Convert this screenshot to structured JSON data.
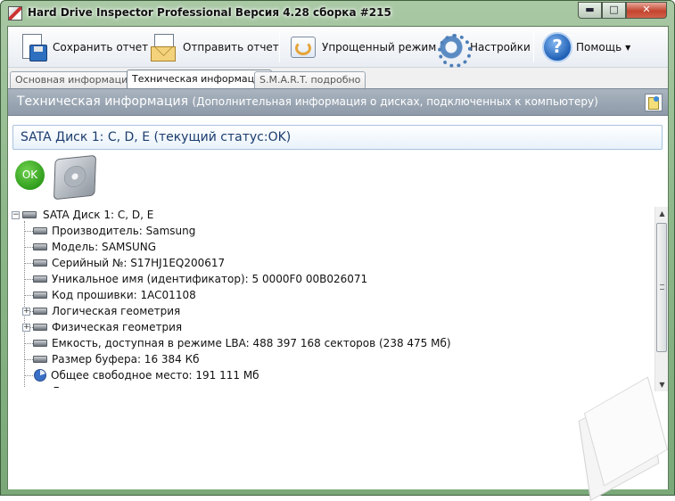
{
  "window": {
    "title": "Hard Drive Inspector Professional Версия 4.28 сборка #215"
  },
  "toolbar": {
    "save_label": "Сохранить отчет",
    "send_label": "Отправить отчет",
    "simple_label": "Упрощенный режим",
    "settings_label": "Настройки",
    "help_label": "Помощь"
  },
  "tabs": [
    {
      "label": "Основная информация",
      "active": false
    },
    {
      "label": "Техническая информация",
      "active": true
    },
    {
      "label": "S.M.A.R.T. подробно",
      "active": false
    }
  ],
  "panel": {
    "title": "Техническая информация",
    "subtitle": "(Дополнительная информация о дисках, подключенных к компьютеру)"
  },
  "disk": {
    "header": "SATA Диск 1: C, D, E (текущий статус:OK)",
    "status_badge": "OK"
  },
  "tree": {
    "root": "SATA Диск 1: C, D, E",
    "items": [
      {
        "text": "Производитель: Samsung",
        "icon": "hdd-icon",
        "expandable": false
      },
      {
        "text": "Модель: SAMSUNG",
        "icon": "hdd-icon",
        "expandable": false
      },
      {
        "text": "Серийный №: S17HJ1EQ200617",
        "icon": "hdd-icon",
        "expandable": false
      },
      {
        "text": "Уникальное имя (идентификатор): 5 0000F0 00B026071",
        "icon": "hdd-icon",
        "expandable": false
      },
      {
        "text": "Код прошивки: 1AC01108",
        "icon": "hdd-icon",
        "expandable": false
      },
      {
        "text": "Логическая геометрия",
        "icon": "hdd-icon",
        "expandable": true
      },
      {
        "text": "Физическая геометрия",
        "icon": "hdd-icon",
        "expandable": true
      },
      {
        "text": "Емкость, доступная в режиме LBA: 488 397 168 секторов (238 475 Мб)",
        "icon": "hdd-icon",
        "expandable": false
      },
      {
        "text": "Размер буфера: 16 384 Кб",
        "icon": "hdd-icon",
        "expandable": false
      },
      {
        "text": "Общее свободное место: 191 111 Мб",
        "icon": "pie-chart-icon",
        "expandable": false
      },
      {
        "text": "Логические диски",
        "icon": "hdd-icon",
        "expandable": true
      }
    ]
  }
}
